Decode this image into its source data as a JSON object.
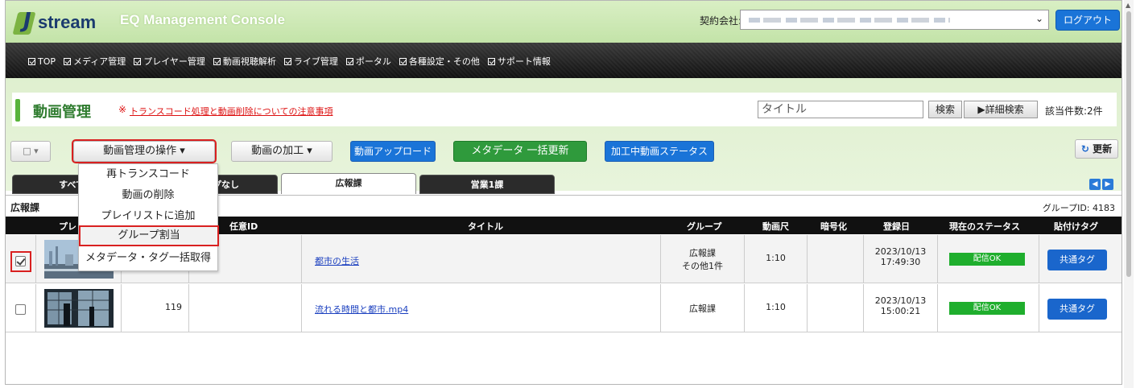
{
  "app": {
    "logo_text": "stream",
    "logo_j": "J",
    "console_title": "EQ Management Console",
    "contract_label": "契約会社:",
    "logout_label": "ログアウト"
  },
  "nav": {
    "items": [
      "TOP",
      "メディア管理",
      "プレイヤー管理",
      "動画視聴解析",
      "ライブ管理",
      "ポータル",
      "各種設定・その他",
      "サポート情報"
    ]
  },
  "page": {
    "title": "動画管理",
    "notice_mark": "※",
    "notice_link": "トランスコード処理と動画削除についての注意事項",
    "search_placeholder": "タイトル",
    "search_label": "検索",
    "advanced_search_label": "▶詳細検索",
    "count_text": "該当件数:2件"
  },
  "toolbar": {
    "select_label": "□ ▾",
    "operations_label": "動画管理の操作 ▾",
    "processing_label": "動画の加工 ▾",
    "upload_label": "動画アップロード",
    "metadata_label": "メタデータ 一括更新",
    "processing_status_label": "加工中動画ステータス",
    "refresh_label": "更新"
  },
  "dropdown": {
    "items": [
      "再トランスコード",
      "動画の削除",
      "プレイリストに追加",
      "グループ割当",
      "メタデータ・タグ一括取得"
    ],
    "highlighted": "グループ割当"
  },
  "tabs": [
    {
      "label": "すべて",
      "active": false
    },
    {
      "label": "プなし",
      "active": false
    },
    {
      "label": "広報課",
      "active": true
    },
    {
      "label": "営業1課",
      "active": false
    }
  ],
  "group": {
    "name": "広報課",
    "id_text": "グループID: 4183"
  },
  "table": {
    "headers": [
      "プレ",
      "任意ID",
      "タイトル",
      "グループ",
      "動画尺",
      "暗号化",
      "登録日",
      "現在のステータス",
      "貼付けタグ"
    ],
    "rows": [
      {
        "checked": true,
        "num": "",
        "custom_id": "",
        "title": "都市の生活",
        "group_line1": "広報課",
        "group_line2": "その他1件",
        "duration": "1:10",
        "encrypted": "",
        "date": "2023/10/13",
        "time": "17:49:30",
        "status": "配信OK",
        "tag": "共通タグ"
      },
      {
        "checked": false,
        "num": "119",
        "custom_id": "",
        "title": "流れる時間と都市.mp4",
        "group_line1": "広報課",
        "group_line2": "",
        "duration": "1:10",
        "encrypted": "",
        "date": "2023/10/13",
        "time": "15:00:21",
        "status": "配信OK",
        "tag": "共通タグ"
      }
    ]
  },
  "colors": {
    "brand_green": "#58b33b",
    "header_bg": "#c3e3a8",
    "nav_bg": "#111111",
    "primary_blue": "#1a74d8",
    "status_green": "#1fae2d",
    "highlight_red": "#d92020"
  }
}
